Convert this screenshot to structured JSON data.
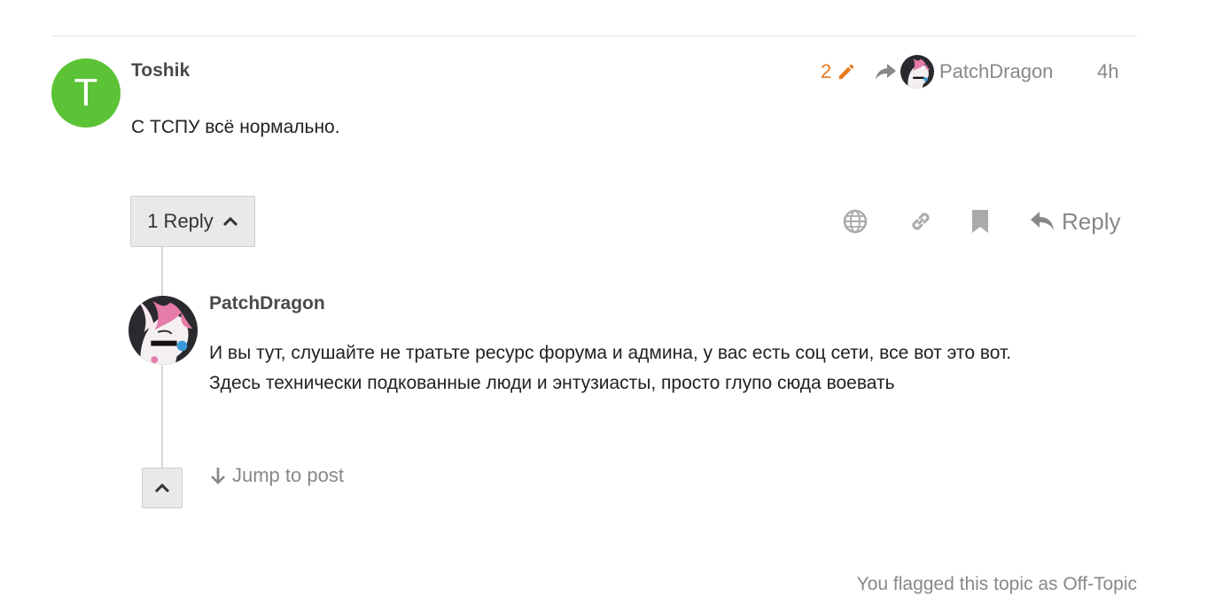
{
  "post": {
    "avatar_letter": "T",
    "avatar_color": "#5cc236",
    "username": "Toshik",
    "edit_count": "2",
    "reply_to_user": "PatchDragon",
    "time": "4h",
    "body": "С ТСПУ всё нормально.",
    "replies_label": "1 Reply",
    "reply_label": "Reply",
    "icons": [
      "pencil-icon",
      "share-arrow-icon",
      "globe-icon",
      "link-icon",
      "bookmark-icon",
      "reply-icon",
      "chevron-up-icon"
    ]
  },
  "reply": {
    "username": "PatchDragon",
    "body": "И вы тут, слушайте не тратьте ресурс форума и админа, у вас есть соц сети, все вот это вот. Здесь технически подкованные люди и энтузиасты, просто глупо сюда воевать",
    "jump_label": "Jump to post"
  },
  "footer": {
    "flag_note": "You flagged this topic as Off-Topic"
  },
  "colors": {
    "accent_orange": "#e87a1f",
    "muted": "#888888"
  }
}
